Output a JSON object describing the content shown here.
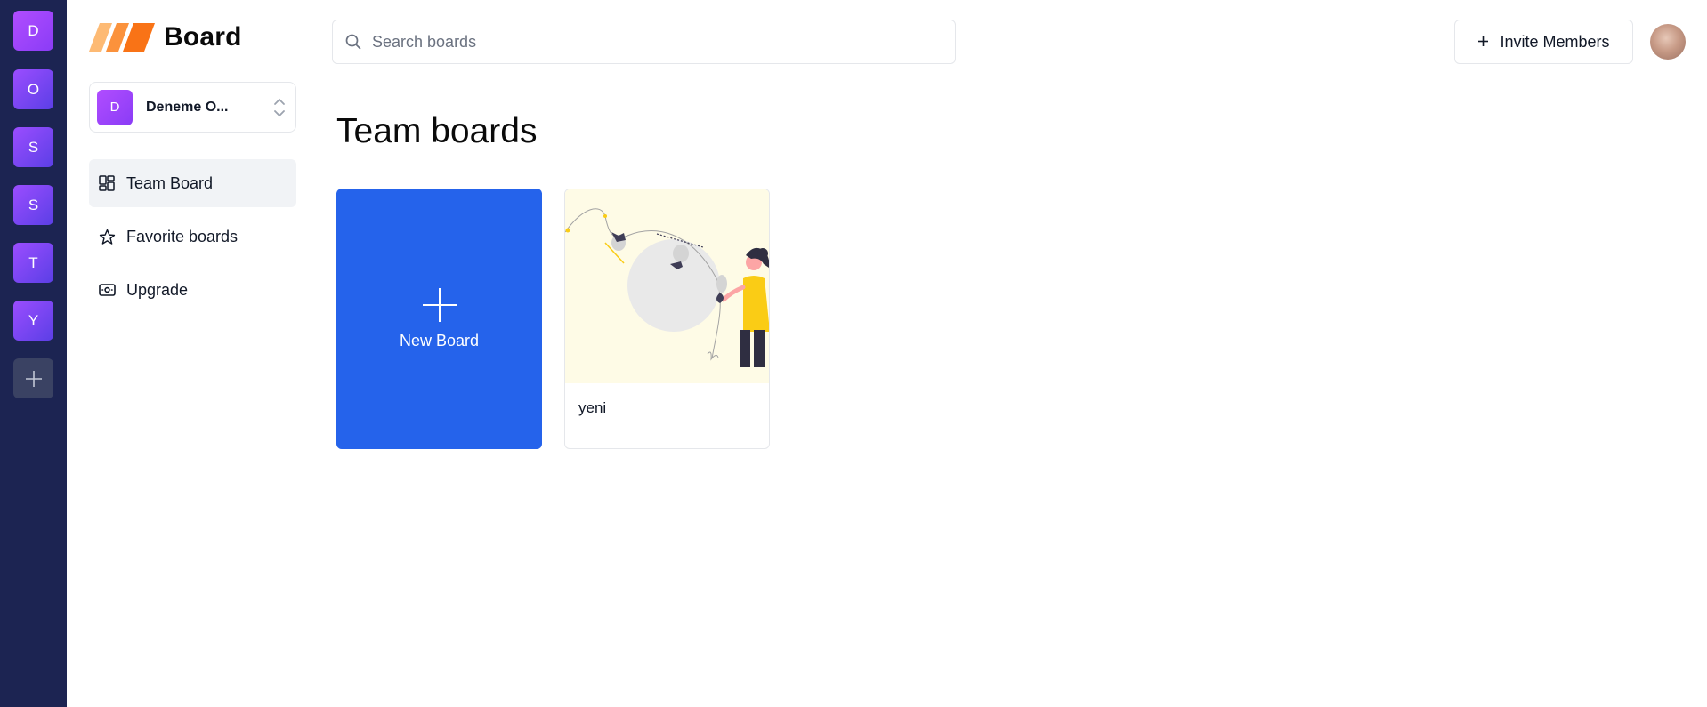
{
  "org_rail": {
    "items": [
      {
        "letter": "D"
      },
      {
        "letter": "O"
      },
      {
        "letter": "S"
      },
      {
        "letter": "S"
      },
      {
        "letter": "T"
      },
      {
        "letter": "Y"
      }
    ],
    "add_label": "+"
  },
  "logo": {
    "text": "Board",
    "colors": [
      "#fdba74",
      "#fb923c",
      "#f97316"
    ]
  },
  "org_switcher": {
    "badge": "D",
    "name": "Deneme O..."
  },
  "nav": {
    "items": [
      {
        "label": "Team Board",
        "icon": "dashboard-icon",
        "active": true
      },
      {
        "label": "Favorite boards",
        "icon": "star-icon",
        "active": false
      },
      {
        "label": "Upgrade",
        "icon": "banknote-icon",
        "active": false
      }
    ]
  },
  "search": {
    "placeholder": "Search boards",
    "value": ""
  },
  "header": {
    "invite_label": "Invite Members",
    "invite_icon": "plus-icon"
  },
  "main": {
    "title": "Team boards",
    "new_board_label": "New Board",
    "boards": [
      {
        "title": "yeni",
        "image": "fishing-illustration"
      }
    ]
  },
  "colors": {
    "rail_bg": "#1c2452",
    "accent": "#2563eb",
    "org_badge": "#9b4dff"
  }
}
